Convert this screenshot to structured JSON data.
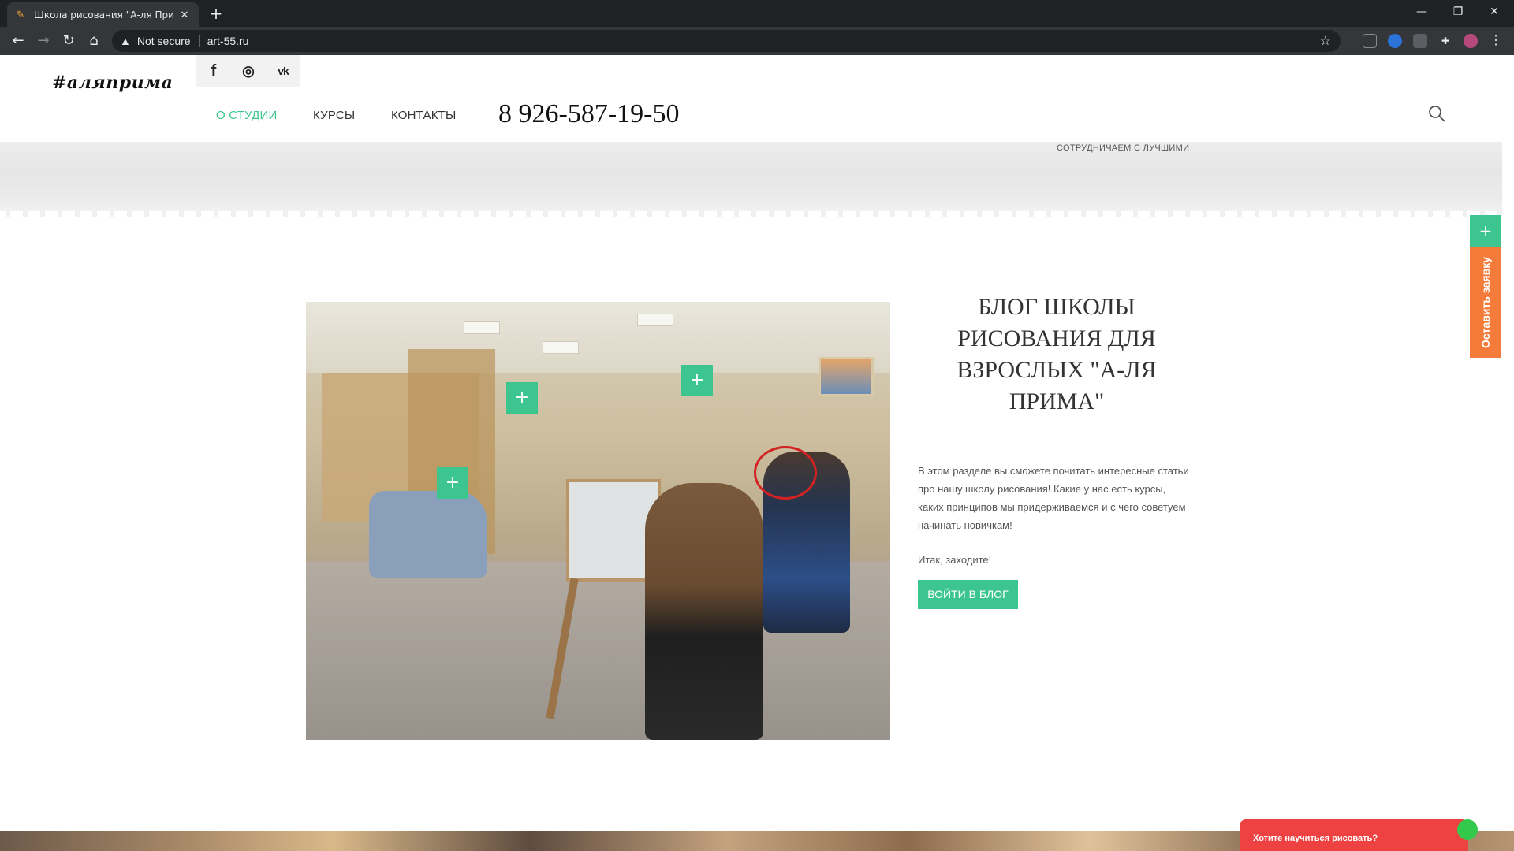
{
  "browser": {
    "tab_title": "Школа рисования \"А-ля Прима\"",
    "tab_close": "✕",
    "new_tab": "+",
    "window_controls": {
      "minimize": "—",
      "maximize": "❐",
      "close": "✕"
    },
    "nav_icons": {
      "back": "←",
      "forward": "→",
      "reload": "↻",
      "home": "⌂"
    },
    "security_label": "Not secure",
    "url": "art-55.ru",
    "star_icon": "☆"
  },
  "site": {
    "logo": "#аляприма",
    "socials": {
      "facebook": "f",
      "instagram": "◎",
      "vk": "vk"
    },
    "nav": [
      {
        "label": "О СТУДИИ",
        "active": true
      },
      {
        "label": "КУРСЫ",
        "active": false
      },
      {
        "label": "КОНТАКТЫ",
        "active": false
      }
    ],
    "phone": "8 926-587-19-50",
    "cooperate_text": "СОТРУДНИЧАЕМ С ЛУЧШИМИ"
  },
  "blog": {
    "title": "БЛОГ ШКОЛЫ РИСОВАНИЯ ДЛЯ ВЗРОСЛЫХ \"А-ЛЯ ПРИМА\"",
    "description": "В этом разделе вы сможете почитать интересные статьи про нашу школу рисования! Какие у нас есть курсы, каких принципов мы придерживаемся и с чего советуем начинать новичкам!",
    "cta_text": "Итак, заходите!",
    "button_label": "ВОЙТИ В БЛОГ"
  },
  "photo_hotspots": {
    "label": "+"
  },
  "side_widget": {
    "plus": "+",
    "label": "Оставить заявку"
  },
  "chat_widget": {
    "label": "Хотите научиться рисовать?"
  },
  "colors": {
    "accent": "#3cc58e",
    "orange": "#f47b3a",
    "chat_red": "#ee4242"
  }
}
